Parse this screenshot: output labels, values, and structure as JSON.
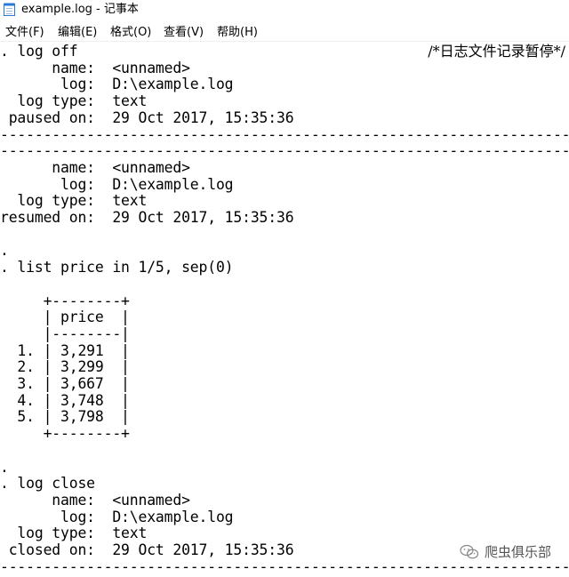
{
  "window": {
    "title": "example.log - 记事本"
  },
  "menu": {
    "file": "文件(F)",
    "edit": "编辑(E)",
    "format": "格式(O)",
    "view": "查看(V)",
    "help": "帮助(H)"
  },
  "editor": {
    "comment": "/*日志文件记录暂停*/",
    "content": ". log off\n      name:  <unnamed>\n       log:  D:\\example.log\n  log type:  text\n paused on:  29 Oct 2017, 15:35:36\n---------------------------------------------------------------------------------\n---------------------------------------------------------------------------------\n      name:  <unnamed>\n       log:  D:\\example.log\n  log type:  text\nresumed on:  29 Oct 2017, 15:35:36\n\n.\n. list price in 1/5, sep(0)\n\n     +--------+\n     | price  |\n     |--------|\n  1. | 3,291  |\n  2. | 3,299  |\n  3. | 3,667  |\n  4. | 3,748  |\n  5. | 3,798  |\n     +--------+\n\n.\n. log close\n      name:  <unnamed>\n       log:  D:\\example.log\n  log type:  text\n closed on:  29 Oct 2017, 15:35:36\n---------------------------------------------------------------------------------"
  },
  "watermark": {
    "text": "爬虫俱乐部"
  },
  "colors": {
    "background": "#ffffff",
    "text": "#000000",
    "icon_blue": "#2b79d6"
  }
}
